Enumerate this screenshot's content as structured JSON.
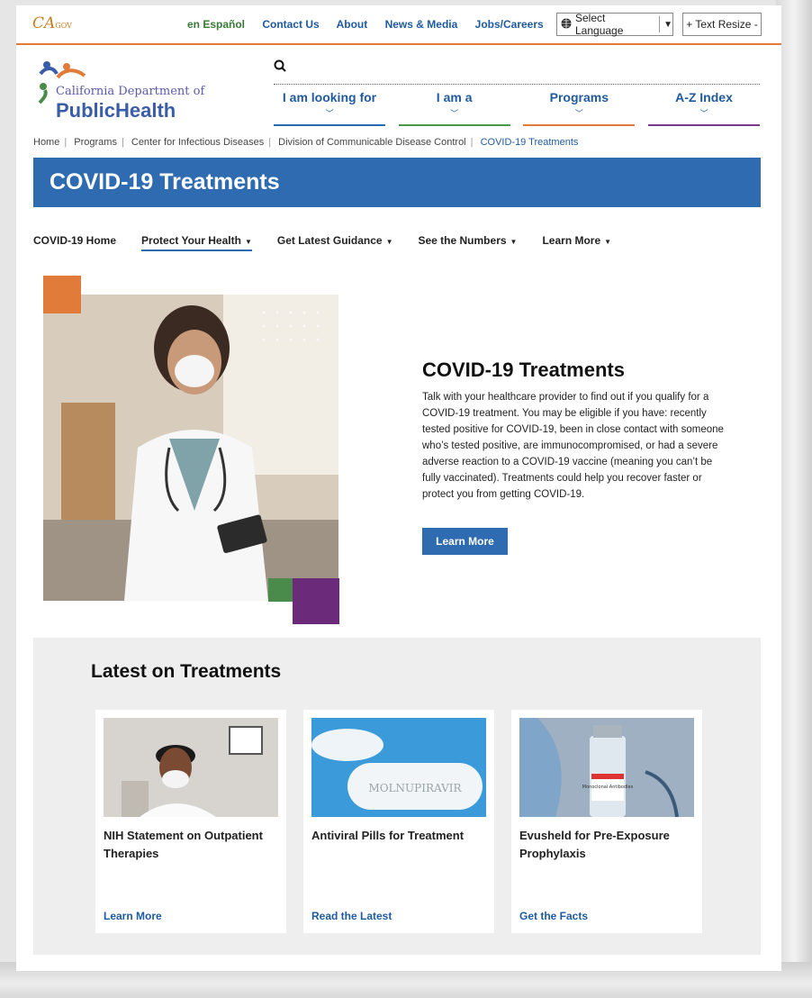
{
  "util": {
    "cagov": "CA",
    "cagov_sub": "GOV",
    "links": [
      "en Español",
      "Contact Us",
      "About",
      "News & Media",
      "Jobs/Careers"
    ],
    "language": "Select Language",
    "resize": "+ Text Resize -"
  },
  "header": {
    "dept": "California Department of",
    "name": "PublicHealth",
    "nav": [
      "I am looking for",
      "I am a",
      "Programs",
      "A-Z Index"
    ]
  },
  "breadcrumb": [
    "Home",
    "Programs",
    "Center for Infectious Diseases",
    "Division of Communicable Disease Control",
    "COVID-19 Treatments"
  ],
  "banner": {
    "title": "COVID-19 Treatments"
  },
  "subnav": [
    "COVID-19 Home",
    "Protect Your Health",
    "Get Latest Guidance",
    "See the Numbers",
    "Learn More"
  ],
  "hero": {
    "title": "COVID-19 Treatments",
    "body": "Talk with your healthcare provider to find out if you qualify for a COVID-19 treatment. You may be eligible if you have: recently tested positive for COVID-19, been in close contact with someone who’s tested positive, are immunocompromised, or had a severe adverse reaction to a COVID-19 vaccine (meaning you can’t be fully vaccinated). Treatments could help you recover faster or protect you from getting COVID-19.",
    "button": "Learn More"
  },
  "latest": {
    "heading": "Latest on Treatments",
    "cards": [
      {
        "title": "NIH Statement on Outpatient Therapies",
        "link": "Learn More"
      },
      {
        "title": "Antiviral Pills for Treatment",
        "link": "Read the Latest",
        "pill_text": "MOLNUPIRAVIR"
      },
      {
        "title": "Evusheld for Pre-Exposure Prophylaxis",
        "link": "Get the Facts",
        "vial_text": "Monoclonal Antibodies"
      }
    ]
  },
  "colors": {
    "primary": "#2f6bb0",
    "orange": "#e07b39",
    "green": "#4a8a4a",
    "purple": "#6b2a7a"
  }
}
